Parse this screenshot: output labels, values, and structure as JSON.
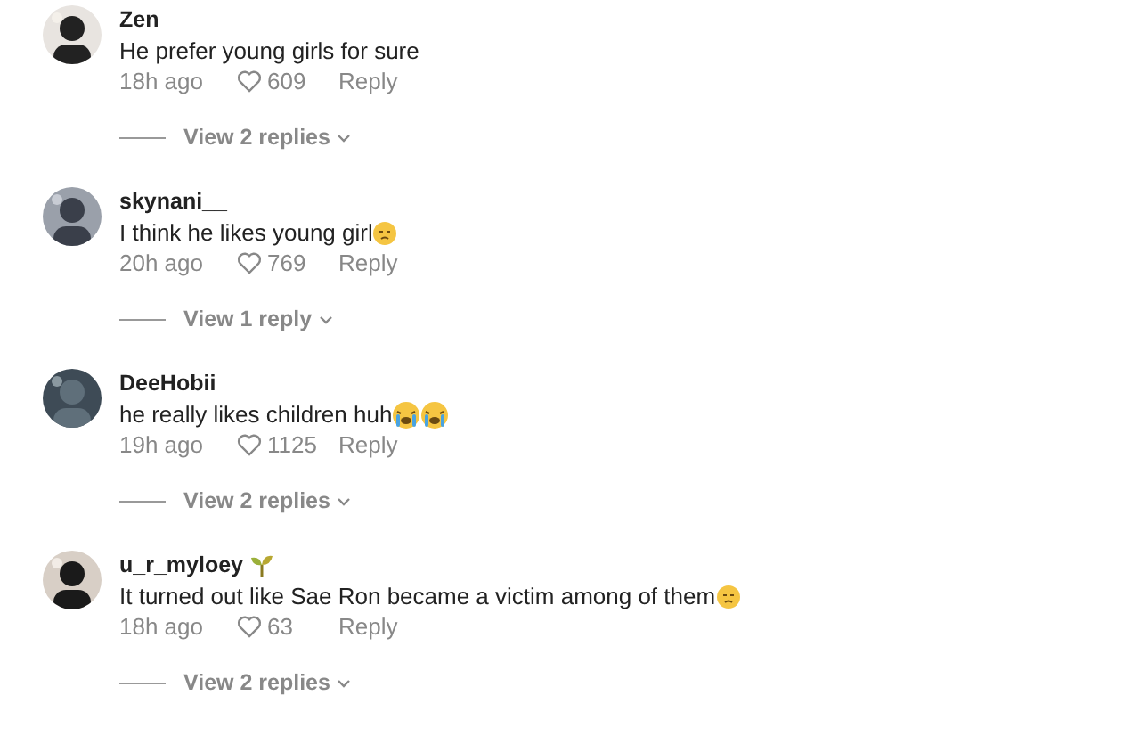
{
  "comments": [
    {
      "user": "Zen",
      "text": "He prefer young girls for sure",
      "time": "18h ago",
      "likes": "609",
      "reply": "Reply",
      "replies": "View 2 replies"
    },
    {
      "user": "skynani__",
      "text": "I think he likes young girl",
      "emojis": [
        {
          "kind": "downcast"
        }
      ],
      "time": "20h ago",
      "likes": "769",
      "reply": "Reply",
      "replies": "View 1 reply"
    },
    {
      "user": "DeeHobii",
      "text": "he really likes children huh",
      "emojis": [
        {
          "kind": "crying"
        },
        {
          "kind": "crying"
        }
      ],
      "time": "19h ago",
      "likes": "1125",
      "reply": "Reply",
      "replies": "View 2 replies"
    },
    {
      "user": "u_r_myloey",
      "badge": {
        "kind": "sprout"
      },
      "text": "It turned out like Sae Ron became a victim among of them",
      "emojis": [
        {
          "kind": "downcast"
        }
      ],
      "time": "18h ago",
      "likes": "63",
      "reply": "Reply",
      "replies": "View 2 replies"
    }
  ]
}
